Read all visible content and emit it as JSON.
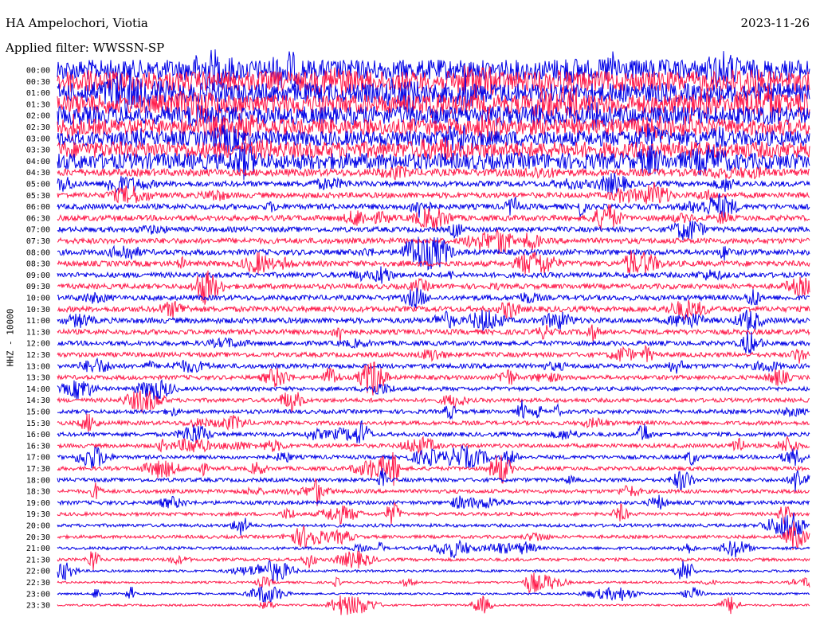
{
  "header": {
    "station": "HA Ampelochori, Viotia",
    "filter": "Applied filter: WWSSN-SP",
    "date": "2023-11-26"
  },
  "channel_label": "HHZ - 10000",
  "chart_data": {
    "type": "line",
    "title": "HA Ampelochori, Viotia",
    "subtitle": "Applied filter: WWSSN-SP",
    "date": "2023-11-26",
    "ylabel": "HHZ - 10000",
    "tick_labels": [
      "00:00",
      "00:30",
      "01:00",
      "01:30",
      "02:00",
      "02:30",
      "03:00",
      "03:30",
      "04:00",
      "04:30",
      "05:00",
      "05:30",
      "06:00",
      "06:30",
      "07:00",
      "07:30",
      "08:00",
      "08:30",
      "09:00",
      "09:30",
      "10:00",
      "10:30",
      "11:00",
      "11:30",
      "12:00",
      "12:30",
      "13:00",
      "13:30",
      "14:00",
      "14:30",
      "15:00",
      "15:30",
      "16:00",
      "16:30",
      "17:00",
      "17:30",
      "18:00",
      "18:30",
      "19:00",
      "19:30",
      "20:00",
      "20:30",
      "21:00",
      "21:30",
      "22:00",
      "22:30",
      "23:00",
      "23:30"
    ],
    "colors": [
      "#0000e6",
      "#ff1a4a"
    ],
    "relative_activity": [
      0.95,
      0.95,
      0.9,
      0.9,
      0.85,
      0.75,
      0.7,
      0.75,
      0.75,
      0.3,
      0.22,
      0.22,
      0.22,
      0.22,
      0.2,
      0.22,
      0.22,
      0.22,
      0.2,
      0.2,
      0.2,
      0.22,
      0.22,
      0.2,
      0.18,
      0.18,
      0.18,
      0.16,
      0.15,
      0.15,
      0.15,
      0.15,
      0.15,
      0.15,
      0.14,
      0.14,
      0.14,
      0.14,
      0.14,
      0.12,
      0.11,
      0.11,
      0.1,
      0.1,
      0.07,
      0.06,
      0.05,
      0.05
    ],
    "grid": false
  }
}
